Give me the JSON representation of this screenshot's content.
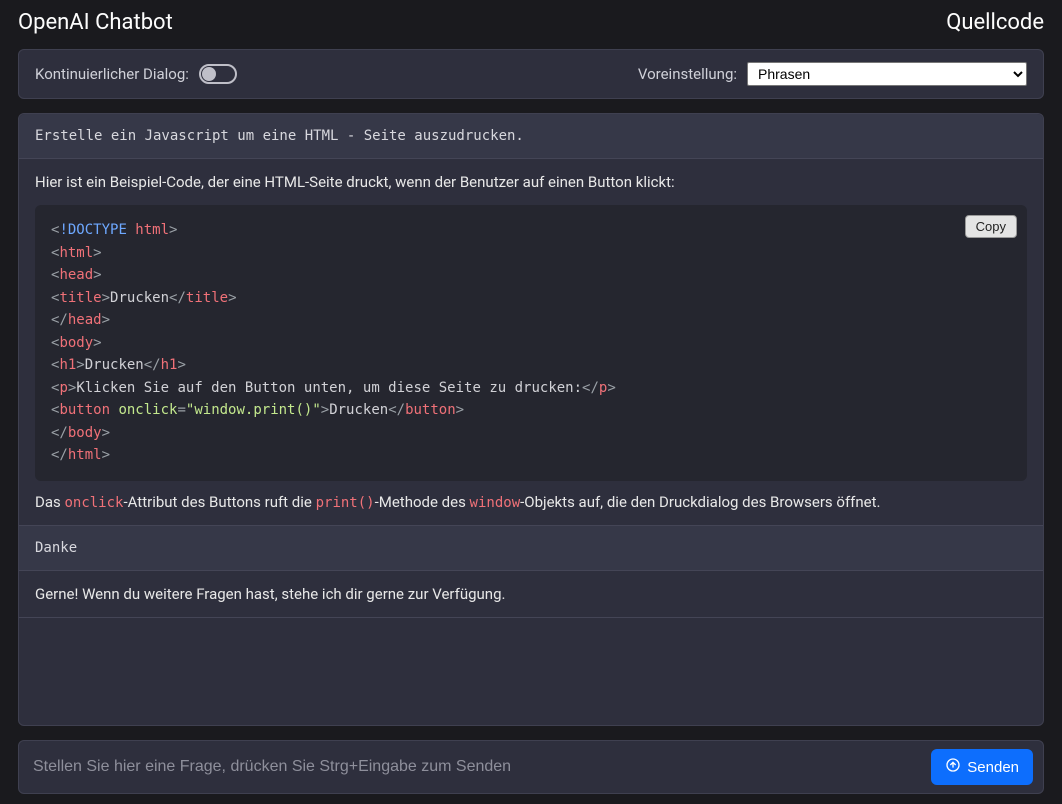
{
  "header": {
    "title": "OpenAI Chatbot",
    "source_link": "Quellcode"
  },
  "settings": {
    "dialog_label": "Kontinuierlicher Dialog:",
    "dialog_on": false,
    "preset_label": "Voreinstellung:",
    "preset_selected": "Phrasen",
    "preset_options": [
      "Phrasen"
    ]
  },
  "chat": {
    "messages": [
      {
        "role": "user",
        "text": "Erstelle ein Javascript um eine HTML - Seite auszudrucken."
      },
      {
        "role": "assistant",
        "intro": "Hier ist ein Beispiel-Code, der eine HTML-Seite druckt, wenn der Benutzer auf einen Button klickt:",
        "code": {
          "copy_label": "Copy",
          "tokens": [
            [
              [
                "angle",
                "<"
              ],
              [
                "doctype",
                "!DOCTYPE "
              ],
              [
                "doctype2",
                "html"
              ],
              [
                "angle",
                ">"
              ]
            ],
            [
              [
                "angle",
                "<"
              ],
              [
                "tag",
                "html"
              ],
              [
                "angle",
                ">"
              ]
            ],
            [
              [
                "angle",
                "<"
              ],
              [
                "tag",
                "head"
              ],
              [
                "angle",
                ">"
              ]
            ],
            [
              [
                "angle",
                "<"
              ],
              [
                "tag",
                "title"
              ],
              [
                "angle",
                ">"
              ],
              [
                "text",
                "Drucken"
              ],
              [
                "angle",
                "</"
              ],
              [
                "tag",
                "title"
              ],
              [
                "angle",
                ">"
              ]
            ],
            [
              [
                "angle",
                "</"
              ],
              [
                "tag",
                "head"
              ],
              [
                "angle",
                ">"
              ]
            ],
            [
              [
                "angle",
                "<"
              ],
              [
                "tag",
                "body"
              ],
              [
                "angle",
                ">"
              ]
            ],
            [
              [
                "angle",
                "<"
              ],
              [
                "tag",
                "h1"
              ],
              [
                "angle",
                ">"
              ],
              [
                "text",
                "Drucken"
              ],
              [
                "angle",
                "</"
              ],
              [
                "tag",
                "h1"
              ],
              [
                "angle",
                ">"
              ]
            ],
            [
              [
                "angle",
                "<"
              ],
              [
                "tag",
                "p"
              ],
              [
                "angle",
                ">"
              ],
              [
                "text",
                "Klicken Sie auf den Button unten, um diese Seite zu drucken:"
              ],
              [
                "angle",
                "</"
              ],
              [
                "tag",
                "p"
              ],
              [
                "angle",
                ">"
              ]
            ],
            [
              [
                "angle",
                "<"
              ],
              [
                "tag",
                "button"
              ],
              [
                "text",
                " "
              ],
              [
                "attr",
                "onclick"
              ],
              [
                "angle",
                "="
              ],
              [
                "string",
                "\"window.print()\""
              ],
              [
                "angle",
                ">"
              ],
              [
                "text",
                "Drucken"
              ],
              [
                "angle",
                "</"
              ],
              [
                "tag",
                "button"
              ],
              [
                "angle",
                ">"
              ]
            ],
            [
              [
                "angle",
                "</"
              ],
              [
                "tag",
                "body"
              ],
              [
                "angle",
                ">"
              ]
            ],
            [
              [
                "angle",
                "</"
              ],
              [
                "tag",
                "html"
              ],
              [
                "angle",
                ">"
              ]
            ]
          ]
        },
        "outro_parts": [
          {
            "t": "plain",
            "v": "Das "
          },
          {
            "t": "code",
            "v": "onclick"
          },
          {
            "t": "plain",
            "v": "-Attribut des Buttons ruft die "
          },
          {
            "t": "code",
            "v": "print()"
          },
          {
            "t": "plain",
            "v": "-Methode des "
          },
          {
            "t": "code",
            "v": "window"
          },
          {
            "t": "plain",
            "v": "-Objekts auf, die den Druckdialog des Browsers öffnet."
          }
        ]
      },
      {
        "role": "user",
        "text": "Danke"
      },
      {
        "role": "assistant",
        "intro": "Gerne! Wenn du weitere Fragen hast, stehe ich dir gerne zur Verfügung."
      }
    ]
  },
  "input": {
    "placeholder": "Stellen Sie hier eine Frage, drücken Sie Strg+Eingabe zum Senden",
    "send_label": "Senden"
  }
}
